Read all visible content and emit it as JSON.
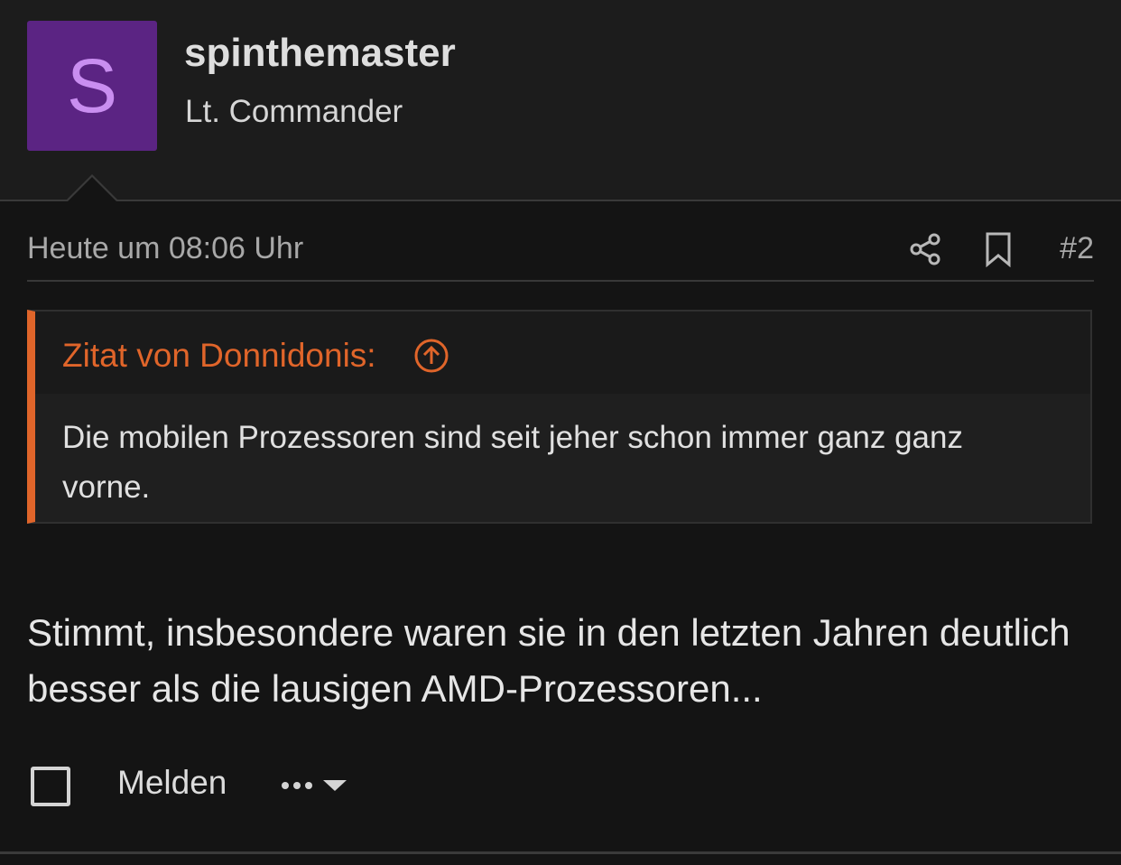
{
  "user": {
    "avatar_letter": "S",
    "avatar_color": "#5b2483",
    "name": "spinthemaster",
    "title": "Lt. Commander"
  },
  "post": {
    "date": "Heute um 08:06 Uhr",
    "number": "#2",
    "quote": {
      "author_label": "Zitat von Donnidonis:",
      "text": "Die mobilen Prozessoren sind seit jeher schon immer ganz ganz vorne."
    },
    "body": "Stimmt, insbesondere waren sie in den letzten Jahren deutlich besser als die lausigen AMD-Prozessoren..."
  },
  "actions": {
    "report_label": "Melden",
    "more_icon": "ellipsis-chevron-down-icon",
    "share_icon": "share-icon",
    "bookmark_icon": "bookmark-icon"
  },
  "colors": {
    "accent": "#e0652a",
    "background": "#141414"
  }
}
